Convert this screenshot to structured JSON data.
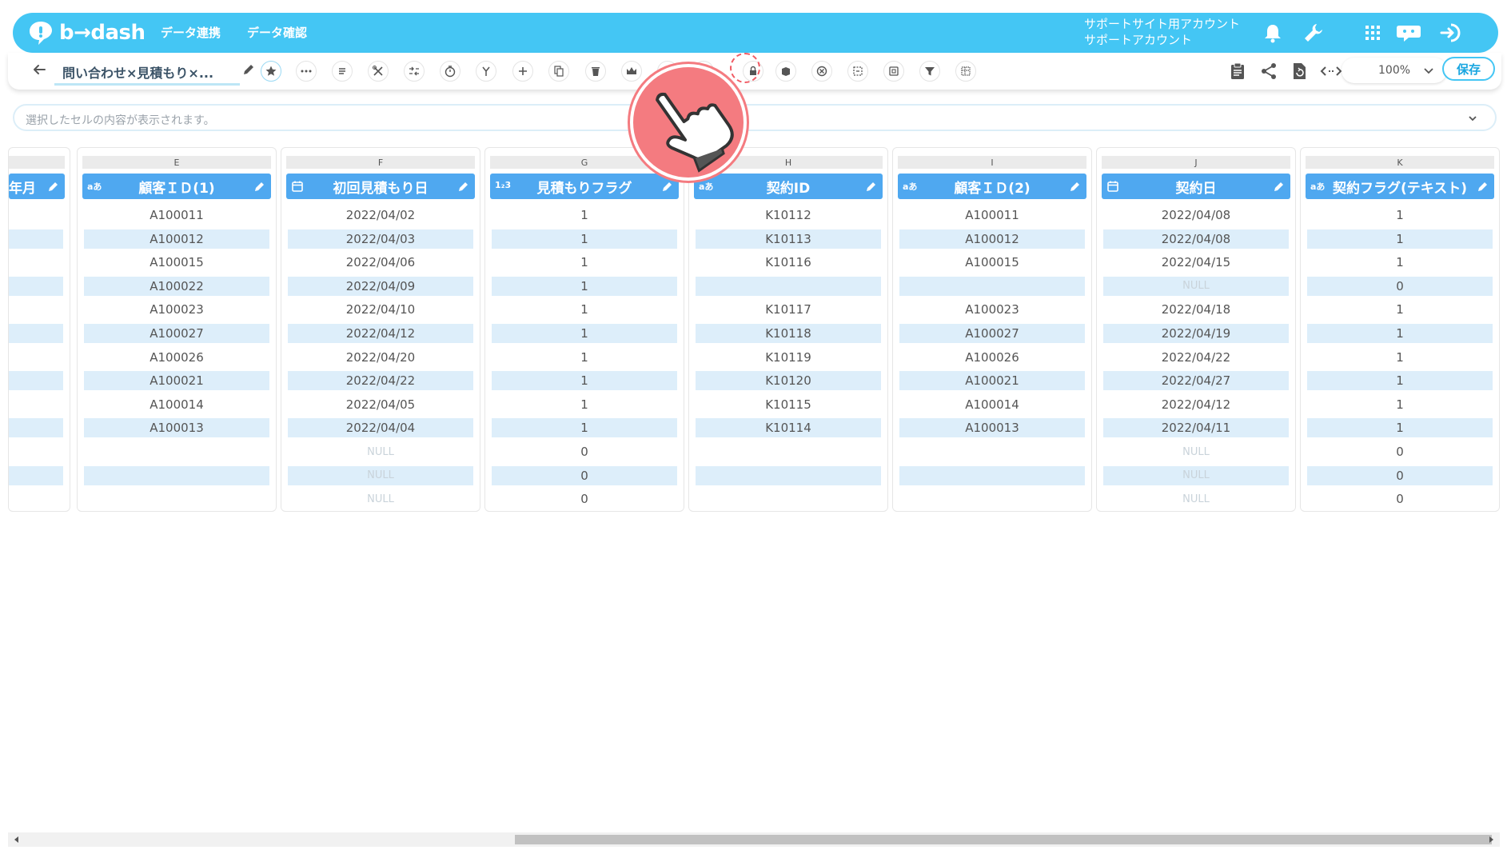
{
  "app": {
    "logo_text": "b→dash"
  },
  "nav": {
    "items": [
      "データ連携",
      "データ確認"
    ]
  },
  "account": {
    "line1": "サポートサイト用アカウント",
    "line2": "サポートアカウント"
  },
  "toolbar": {
    "title": "問い合わせ×見積もり×...",
    "zoom": "100%",
    "save_label": "保存"
  },
  "formula_bar": {
    "placeholder": "選択したセルの内容が表示されます。"
  },
  "grid": {
    "partial_column": {
      "header": "年月"
    },
    "columns": [
      {
        "letter": "E",
        "type_icon": "aあ",
        "header": "顧客ＩＤ(1)",
        "cells": [
          "A100011",
          "A100012",
          "A100015",
          "A100022",
          "A100023",
          "A100027",
          "A100026",
          "A100021",
          "A100014",
          "A100013",
          "",
          "",
          ""
        ]
      },
      {
        "letter": "F",
        "type_icon": "calendar",
        "header": "初回見積もり日",
        "cells": [
          "2022/04/02",
          "2022/04/03",
          "2022/04/06",
          "2022/04/09",
          "2022/04/10",
          "2022/04/12",
          "2022/04/20",
          "2022/04/22",
          "2022/04/05",
          "2022/04/04",
          "NULL",
          "NULL",
          "NULL"
        ]
      },
      {
        "letter": "G",
        "type_icon": "1₂3",
        "header": "見積もりフラグ",
        "cells": [
          "1",
          "1",
          "1",
          "1",
          "1",
          "1",
          "1",
          "1",
          "1",
          "1",
          "0",
          "0",
          "0"
        ]
      },
      {
        "letter": "H",
        "type_icon": "aあ",
        "header": "契約ID",
        "cells": [
          "K10112",
          "K10113",
          "K10116",
          "",
          "K10117",
          "K10118",
          "K10119",
          "K10120",
          "K10115",
          "K10114",
          "",
          "",
          ""
        ]
      },
      {
        "letter": "I",
        "type_icon": "aあ",
        "header": "顧客ＩＤ(2)",
        "cells": [
          "A100011",
          "A100012",
          "A100015",
          "",
          "A100023",
          "A100027",
          "A100026",
          "A100021",
          "A100014",
          "A100013",
          "",
          "",
          ""
        ]
      },
      {
        "letter": "J",
        "type_icon": "calendar",
        "header": "契約日",
        "cells": [
          "2022/04/08",
          "2022/04/08",
          "2022/04/15",
          "NULL",
          "2022/04/18",
          "2022/04/19",
          "2022/04/22",
          "2022/04/27",
          "2022/04/12",
          "2022/04/11",
          "NULL",
          "NULL",
          "NULL"
        ]
      },
      {
        "letter": "K",
        "type_icon": "aあ",
        "header": "契約フラグ(テキスト)",
        "cells": [
          "1",
          "1",
          "1",
          "0",
          "1",
          "1",
          "1",
          "1",
          "1",
          "1",
          "0",
          "0",
          "0"
        ]
      }
    ]
  },
  "colors": {
    "header_bg": "#44c6f4",
    "column_header": "#4fa8f0",
    "row_alt": "#ddeefa",
    "pointer": "#f47b80"
  }
}
